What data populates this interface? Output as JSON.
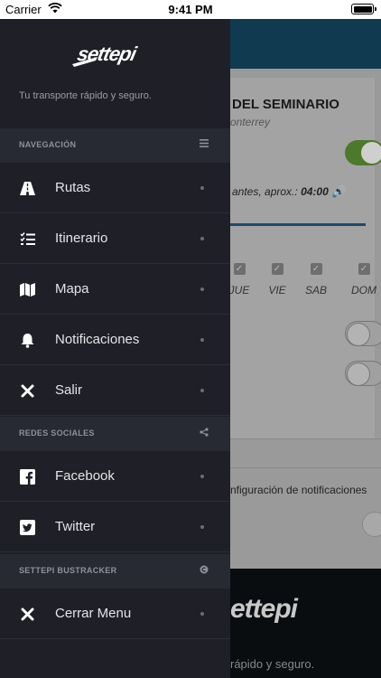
{
  "status_bar": {
    "carrier": "Carrier",
    "time": "9:41 PM"
  },
  "drawer": {
    "brand": "settepi",
    "tagline": "Tu transporte rápido y seguro.",
    "sections": {
      "navigation": {
        "label": "NAVEGACIÓN",
        "icon": "menu-icon"
      },
      "social": {
        "label": "REDES SOCIALES",
        "icon": "share-icon"
      },
      "bustracker": {
        "label": "SETTEPI BUSTRACKER",
        "icon": "copyright-icon"
      }
    },
    "nav_items": [
      {
        "label": "Rutas",
        "icon": "road-icon"
      },
      {
        "label": "Itinerario",
        "icon": "list-check-icon"
      },
      {
        "label": "Mapa",
        "icon": "map-icon"
      },
      {
        "label": "Notificaciones",
        "icon": "bell-icon"
      },
      {
        "label": "Salir",
        "icon": "close-icon"
      }
    ],
    "social_items": [
      {
        "label": "Facebook",
        "icon": "facebook-icon"
      },
      {
        "label": "Twitter",
        "icon": "twitter-icon"
      }
    ],
    "bustracker_items": [
      {
        "label": "Cerrar Menu",
        "icon": "close-icon"
      }
    ]
  },
  "background": {
    "title": "DEL SEMINARIO",
    "subtitle": "onterrey",
    "time_prefix": "antes, aprox.:",
    "time_value": "04:00",
    "days": [
      "JUE",
      "VIE",
      "SAB",
      "DOM"
    ],
    "notification_settings": "nfiguración de notificaciones",
    "footer_brand": "ettepi",
    "footer_tagline": "rápido y seguro."
  },
  "colors": {
    "drawer_bg": "#1f2027",
    "section_bg": "#282a33",
    "header_bar": "#0f3a4f",
    "toggle_on": "#4d7a2a"
  }
}
